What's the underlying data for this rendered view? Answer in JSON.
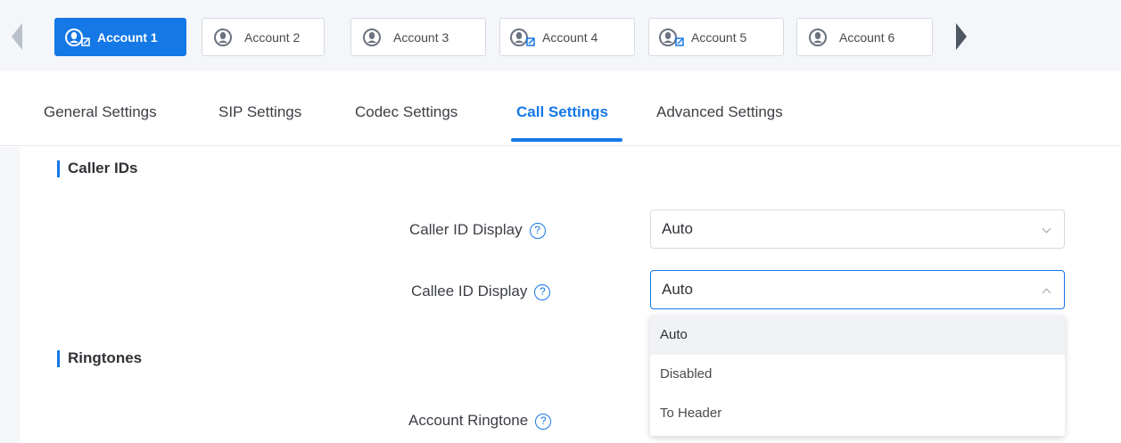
{
  "accounts": {
    "tabs": [
      {
        "label": "Account 1",
        "active": true,
        "icon": "user-edit-icon"
      },
      {
        "label": "Account 2",
        "active": false,
        "icon": "user-icon"
      },
      {
        "label": "Account 3",
        "active": false,
        "icon": "user-icon"
      },
      {
        "label": "Account 4",
        "active": false,
        "icon": "user-edit-icon"
      },
      {
        "label": "Account 5",
        "active": false,
        "icon": "user-edit-icon"
      },
      {
        "label": "Account 6",
        "active": false,
        "icon": "user-icon"
      }
    ]
  },
  "nav": {
    "tabs": [
      {
        "label": "General Settings"
      },
      {
        "label": "SIP Settings"
      },
      {
        "label": "Codec Settings"
      },
      {
        "label": "Call Settings",
        "active": true
      },
      {
        "label": "Advanced Settings"
      }
    ]
  },
  "sections": {
    "caller_ids": "Caller IDs",
    "ringtones": "Ringtones"
  },
  "fields": {
    "caller_id_display": {
      "label": "Caller ID Display",
      "value": "Auto"
    },
    "callee_id_display": {
      "label": "Callee ID Display",
      "value": "Auto"
    },
    "account_ringtone": {
      "label": "Account Ringtone"
    }
  },
  "dropdown": {
    "options": [
      "Auto",
      "Disabled",
      "To Header"
    ],
    "selected": "Auto"
  },
  "colors": {
    "accent": "#1478e6",
    "bar_bg": "#f4f6f9"
  }
}
